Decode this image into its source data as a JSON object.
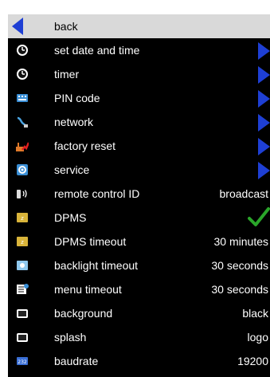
{
  "menu": {
    "items": [
      {
        "label": "back",
        "icon": "back-arrow-icon"
      },
      {
        "label": "set date and time",
        "icon": "clock-icon"
      },
      {
        "label": "timer",
        "icon": "clock-icon"
      },
      {
        "label": "PIN code",
        "icon": "keypad-icon"
      },
      {
        "label": "network",
        "icon": "network-cable-icon"
      },
      {
        "label": "factory reset",
        "icon": "factory-reset-icon"
      },
      {
        "label": "service",
        "icon": "service-icon"
      },
      {
        "label": "remote control ID",
        "value": "broadcast",
        "icon": "remote-control-icon"
      },
      {
        "label": "DPMS",
        "value_icon": "check-icon",
        "icon": "dpms-icon"
      },
      {
        "label": "DPMS timeout",
        "value": "30 minutes",
        "icon": "dpms-icon"
      },
      {
        "label": "backlight timeout",
        "value": "30 seconds",
        "icon": "backlight-icon"
      },
      {
        "label": "menu timeout",
        "value": "30 seconds",
        "icon": "menu-timeout-icon"
      },
      {
        "label": "background",
        "value": "black",
        "icon": "screen-icon"
      },
      {
        "label": "splash",
        "value": "logo",
        "icon": "screen-icon"
      },
      {
        "label": "baudrate",
        "value": "19200",
        "icon": "baudrate-icon"
      }
    ]
  },
  "colors": {
    "background": "#000000",
    "selected_row": "#d9d9d9",
    "text": "#ffffff",
    "accent_arrow": "#1e3fd4",
    "check": "#2aa52a"
  }
}
